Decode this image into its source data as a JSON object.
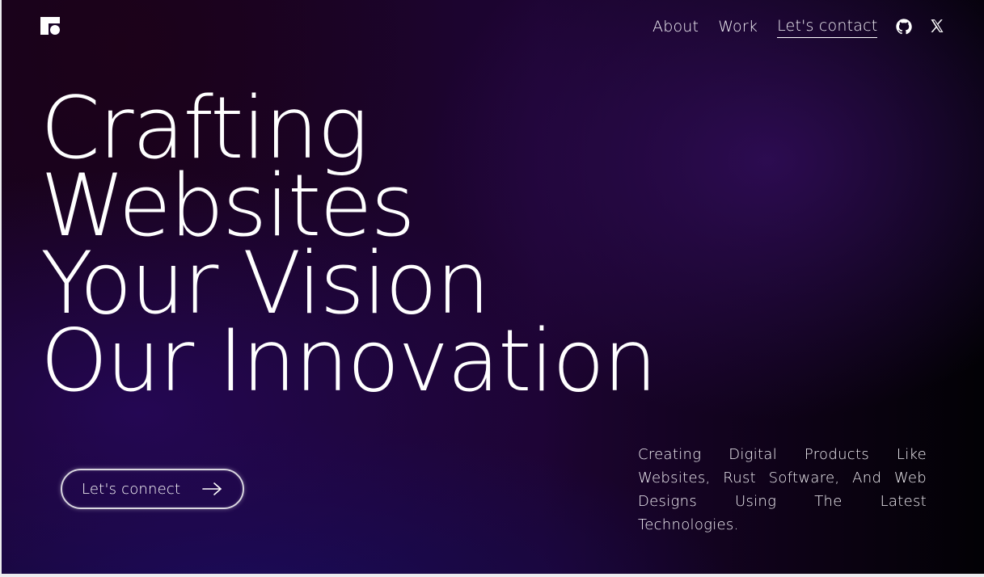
{
  "header": {
    "logo_icon": "brand-logo-icon",
    "nav": {
      "about": "About",
      "work": "Work",
      "contact": "Let's contact"
    },
    "social": {
      "github_icon": "github-icon",
      "x_icon": "x-icon"
    }
  },
  "hero": {
    "headline": {
      "line1": "Crafting",
      "line2": "Websites",
      "line3": "Your Vision",
      "line4": "Our Innovation"
    },
    "cta": {
      "label": "Let's connect",
      "icon": "arrow-right-icon"
    },
    "description": "Creating Digital Products Like Websites, Rust Software, And Web Designs Using The Latest Technologies."
  },
  "colors": {
    "text": "#ffffff",
    "background_dark": "#17031f",
    "background_purple": "#34105f",
    "background_blue": "#160c5a",
    "cta_border": "#d9d6e0"
  }
}
